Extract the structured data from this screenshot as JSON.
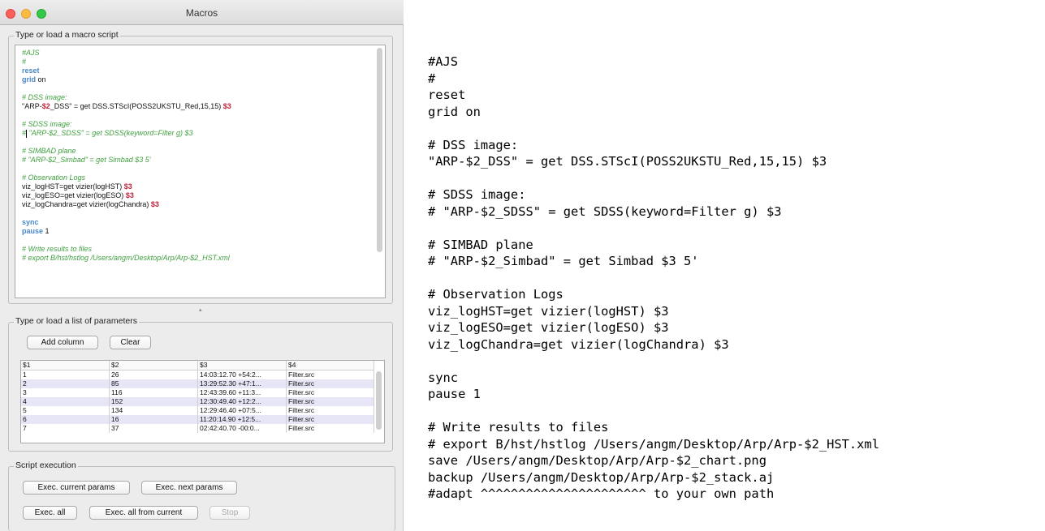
{
  "window": {
    "title": "Macros"
  },
  "script_group": {
    "label": "Type or load a macro script",
    "lines": [
      [
        {
          "t": "#AJS",
          "c": "com"
        }
      ],
      [
        {
          "t": "#",
          "c": "com"
        }
      ],
      [
        {
          "t": "reset",
          "c": "kw"
        }
      ],
      [
        {
          "t": "grid",
          "c": "kw"
        },
        {
          "t": " on",
          "c": "norm"
        }
      ],
      [],
      [
        {
          "t": "# DSS image:",
          "c": "com"
        }
      ],
      [
        {
          "t": "\"ARP-",
          "c": "norm"
        },
        {
          "t": "$2",
          "c": "var"
        },
        {
          "t": "_DSS\" = get DSS.STScI(POSS2UKSTU_Red,15,15) ",
          "c": "norm"
        },
        {
          "t": "$3",
          "c": "var"
        }
      ],
      [],
      [
        {
          "t": "# SDSS image:",
          "c": "com"
        }
      ],
      [
        {
          "t": "#",
          "c": "com"
        },
        {
          "t": "|",
          "c": "caret"
        },
        {
          "t": " \"ARP-$2_SDSS\" = get SDSS(keyword=Filter g) $3",
          "c": "com"
        }
      ],
      [],
      [
        {
          "t": "# SIMBAD plane",
          "c": "com"
        }
      ],
      [
        {
          "t": "# \"ARP-$2_Simbad\" = get Simbad $3 5'",
          "c": "com"
        }
      ],
      [],
      [
        {
          "t": "# Observation Logs",
          "c": "com"
        }
      ],
      [
        {
          "t": "viz_logHST=get vizier(logHST) ",
          "c": "norm"
        },
        {
          "t": "$3",
          "c": "var"
        }
      ],
      [
        {
          "t": "viz_logESO=get vizier(logESO) ",
          "c": "norm"
        },
        {
          "t": "$3",
          "c": "var"
        }
      ],
      [
        {
          "t": "viz_logChandra=get vizier(logChandra) ",
          "c": "norm"
        },
        {
          "t": "$3",
          "c": "var"
        }
      ],
      [],
      [
        {
          "t": "sync",
          "c": "kw"
        }
      ],
      [
        {
          "t": "pause",
          "c": "kw"
        },
        {
          "t": " 1",
          "c": "norm"
        }
      ],
      [],
      [
        {
          "t": "# Write results to files",
          "c": "com"
        }
      ],
      [
        {
          "t": "# export B/hst/hstlog /Users/angm/Desktop/Arp/Arp-$2_HST.xml",
          "c": "com"
        }
      ]
    ]
  },
  "params_group": {
    "label": "Type or load a list of parameters",
    "add_column_label": "Add column",
    "clear_label": "Clear",
    "columns": [
      "$1",
      "$2",
      "$3",
      "$4"
    ],
    "rows": [
      [
        "1",
        "26",
        "14:03:12.70 +54:2...",
        "Filter.src"
      ],
      [
        "2",
        "85",
        "13:29:52.30 +47:1...",
        "Filter.src"
      ],
      [
        "3",
        "116",
        "12:43:39.60 +11:3...",
        "Filter.src"
      ],
      [
        "4",
        "152",
        "12:30:49.40 +12:2...",
        "Filter.src"
      ],
      [
        "5",
        "134",
        "12:29:46.40 +07:5...",
        "Filter.src"
      ],
      [
        "6",
        "16",
        "11:20:14.90 +12:5...",
        "Filter.src"
      ],
      [
        "7",
        "37",
        "02:42:40.70 -00:0...",
        "Filter.src"
      ]
    ]
  },
  "exec_group": {
    "label": "Script execution",
    "exec_current_label": "Exec. current params",
    "exec_next_label": "Exec. next params",
    "exec_all_label": "Exec. all",
    "exec_all_from_current_label": "Exec. all from current",
    "stop_label": "Stop"
  },
  "listing": {
    "lines": [
      "#AJS",
      "#",
      "reset",
      "grid on",
      "",
      "# DSS image:",
      "\"ARP-$2_DSS\" = get DSS.STScI(POSS2UKSTU_Red,15,15) $3",
      "",
      "# SDSS image:",
      "# \"ARP-$2_SDSS\" = get SDSS(keyword=Filter g) $3",
      "",
      "# SIMBAD plane",
      "# \"ARP-$2_Simbad\" = get Simbad $3 5'",
      "",
      "# Observation Logs",
      "viz_logHST=get vizier(logHST) $3",
      "viz_logESO=get vizier(logESO) $3",
      "viz_logChandra=get vizier(logChandra) $3",
      "",
      "sync",
      "pause 1",
      "",
      "# Write results to files",
      "# export B/hst/hstlog /Users/angm/Desktop/Arp/Arp-$2_HST.xml",
      "save /Users/angm/Desktop/Arp/Arp-$2_chart.png",
      "backup /Users/angm/Desktop/Arp/Arp-$2_stack.aj",
      "#adapt ^^^^^^^^^^^^^^^^^^^^^^ to your own path"
    ]
  }
}
